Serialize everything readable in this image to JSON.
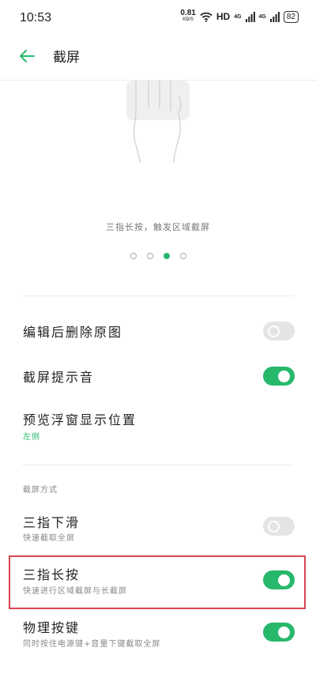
{
  "status_bar": {
    "time": "10:53",
    "net_speed": "0.81",
    "net_unit": "KB/S",
    "hd": "HD",
    "signal1": "4G",
    "signal2": "4G",
    "battery": "82"
  },
  "header": {
    "title": "截屏"
  },
  "hero": {
    "caption": "三指长按，触发区域截屏",
    "page_count": 4,
    "active_page": 3
  },
  "settings": [
    {
      "title": "编辑后删除原图",
      "toggle": false
    },
    {
      "title": "截屏提示音",
      "toggle": true
    },
    {
      "title": "预览浮窗显示位置",
      "value": "左侧"
    }
  ],
  "section": {
    "label": "截屏方式"
  },
  "methods": [
    {
      "title": "三指下滑",
      "subtitle": "快速截取全屏",
      "toggle": false
    },
    {
      "title": "三指长按",
      "subtitle": "快速进行区域截屏与长截屏",
      "toggle": true
    },
    {
      "title": "物理按键",
      "subtitle": "同时按住电源键+音量下键截取全屏",
      "toggle": true
    }
  ],
  "colors": {
    "accent": "#27b86b",
    "highlight": "#d8454d"
  }
}
